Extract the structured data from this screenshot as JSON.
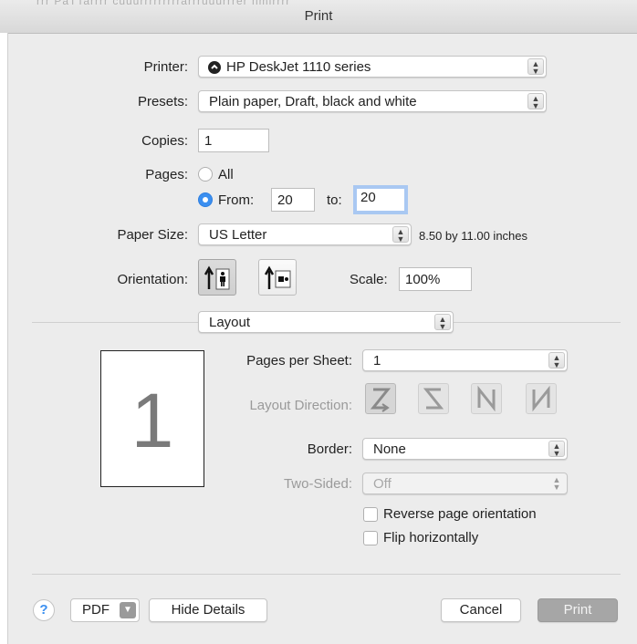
{
  "window": {
    "title": "Print",
    "background_text": "rrr PaTTarrrr cuuurrrrrrrrrarrruuurrrer nmlrrrr"
  },
  "printer": {
    "label": "Printer:",
    "value": "HP DeskJet 1110 series"
  },
  "presets": {
    "label": "Presets:",
    "value": "Plain paper, Draft, black and white"
  },
  "copies": {
    "label": "Copies:",
    "value": "1"
  },
  "pages": {
    "label": "Pages:",
    "all_label": "All",
    "from_label": "From:",
    "from_value": "20",
    "to_label": "to:",
    "to_value": "20",
    "selected": "from"
  },
  "paper_size": {
    "label": "Paper Size:",
    "value": "US Letter",
    "dimensions": "8.50 by 11.00 inches"
  },
  "orientation": {
    "label": "Orientation:",
    "options": [
      "portrait-icon",
      "landscape-icon"
    ],
    "selected": "portrait"
  },
  "scale": {
    "label": "Scale:",
    "value": "100%"
  },
  "section": {
    "value": "Layout"
  },
  "preview": {
    "page_number": "1"
  },
  "layout": {
    "pages_per_sheet": {
      "label": "Pages per Sheet:",
      "value": "1"
    },
    "layout_direction": {
      "label": "Layout Direction:",
      "options": [
        "z-direction-icon",
        "s-direction-icon",
        "reverse-n-direction-icon",
        "n-direction-icon"
      ]
    },
    "border": {
      "label": "Border:",
      "value": "None"
    },
    "two_sided": {
      "label": "Two-Sided:",
      "value": "Off"
    },
    "reverse_page_orientation": {
      "label": "Reverse page orientation",
      "checked": false
    },
    "flip_horizontally": {
      "label": "Flip horizontally",
      "checked": false
    }
  },
  "footer": {
    "help": "?",
    "pdf": "PDF",
    "hide_details": "Hide Details",
    "cancel": "Cancel",
    "print": "Print"
  }
}
